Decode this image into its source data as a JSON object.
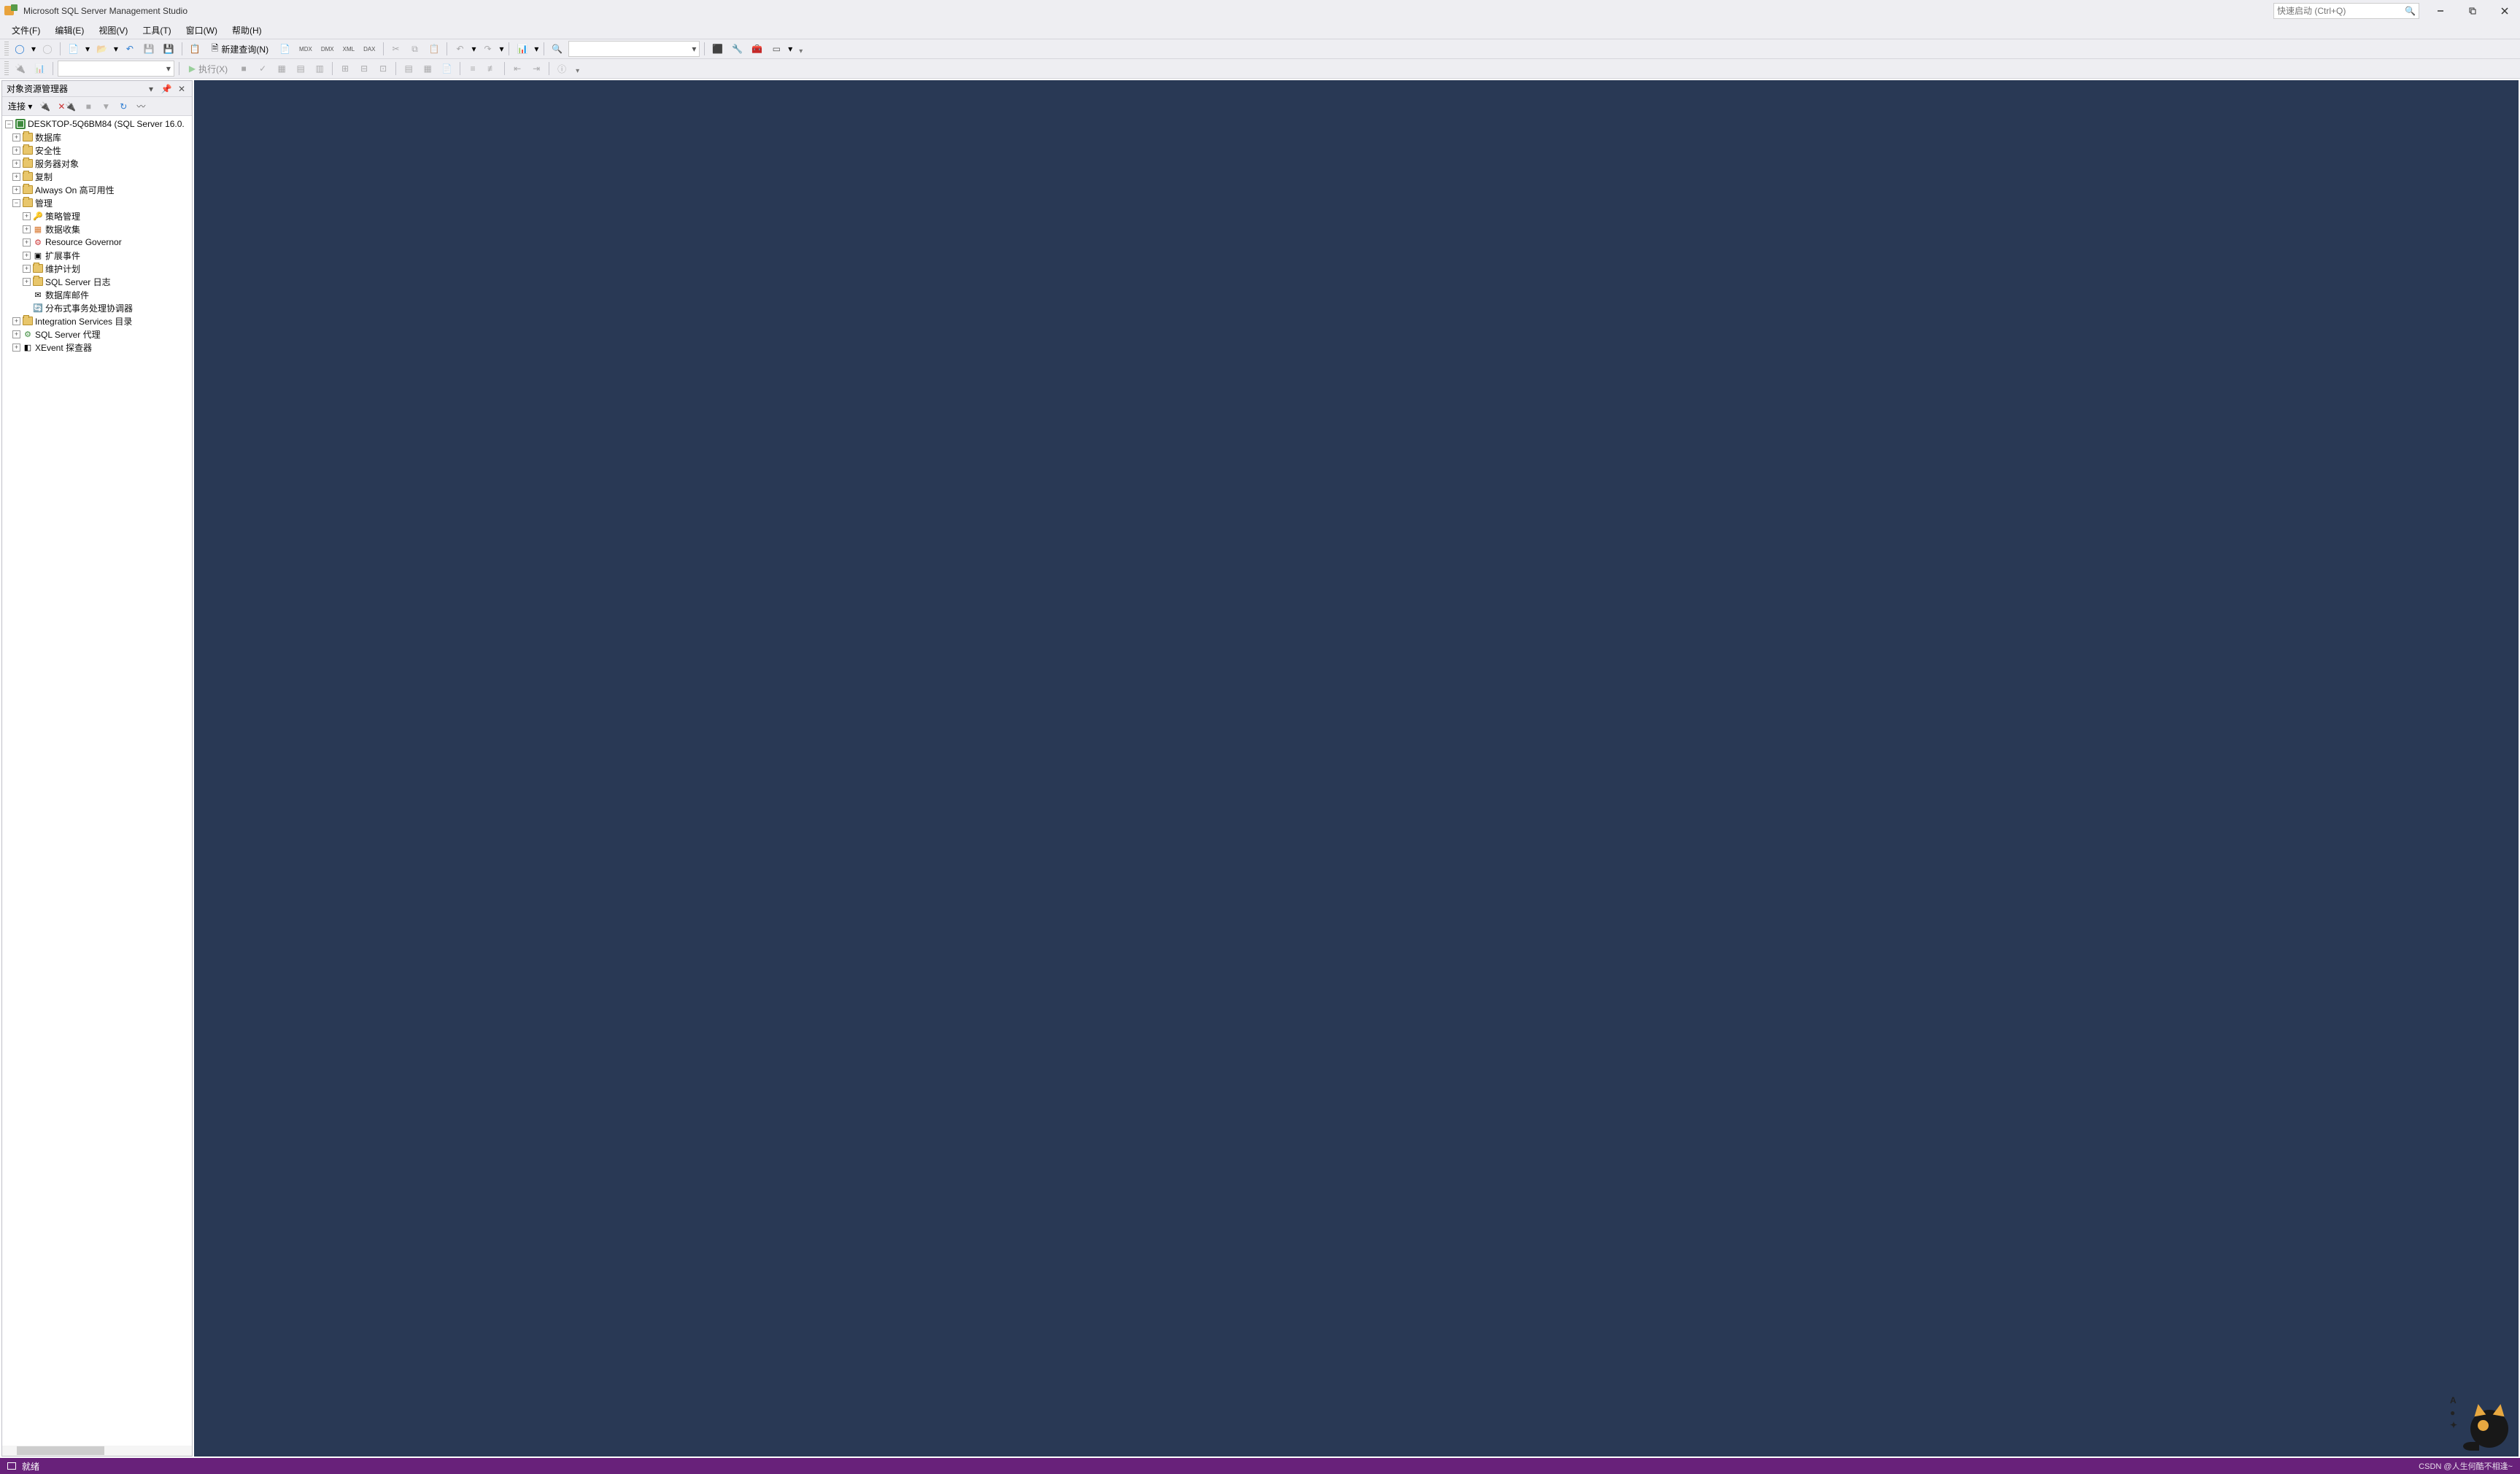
{
  "title": "Microsoft SQL Server Management Studio",
  "quick_launch_placeholder": "快速启动 (Ctrl+Q)",
  "menu": {
    "file": "文件(F)",
    "edit": "编辑(E)",
    "view": "视图(V)",
    "tools": "工具(T)",
    "window": "窗口(W)",
    "help": "帮助(H)"
  },
  "toolbar1": {
    "new_query": "新建查询(N)"
  },
  "toolbar2": {
    "execute": "执行(X)"
  },
  "object_explorer": {
    "title": "对象资源管理器",
    "connect": "连接",
    "root": "DESKTOP-5Q6BM84 (SQL Server 16.0.",
    "nodes": [
      {
        "label": "数据库",
        "icon": "folder",
        "exp": "+",
        "ind": 1
      },
      {
        "label": "安全性",
        "icon": "folder",
        "exp": "+",
        "ind": 1
      },
      {
        "label": "服务器对象",
        "icon": "folder",
        "exp": "+",
        "ind": 1
      },
      {
        "label": "复制",
        "icon": "folder",
        "exp": "+",
        "ind": 1
      },
      {
        "label": "Always On 高可用性",
        "icon": "folder",
        "exp": "+",
        "ind": 1
      },
      {
        "label": "管理",
        "icon": "folder",
        "exp": "-",
        "ind": 1
      },
      {
        "label": "策略管理",
        "icon": "policy",
        "exp": "+",
        "ind": 2
      },
      {
        "label": "数据收集",
        "icon": "data",
        "exp": "+",
        "ind": 2
      },
      {
        "label": "Resource Governor",
        "icon": "rg",
        "exp": "+",
        "ind": 2
      },
      {
        "label": "扩展事件",
        "icon": "ext",
        "exp": "+",
        "ind": 2
      },
      {
        "label": "维护计划",
        "icon": "folder",
        "exp": "+",
        "ind": 2
      },
      {
        "label": "SQL Server 日志",
        "icon": "folder",
        "exp": "+",
        "ind": 2
      },
      {
        "label": "数据库邮件",
        "icon": "mail",
        "exp": "",
        "ind": 2
      },
      {
        "label": "分布式事务处理协调器",
        "icon": "dtc",
        "exp": "",
        "ind": 2
      },
      {
        "label": "Integration Services 目录",
        "icon": "folder",
        "exp": "+",
        "ind": 1
      },
      {
        "label": "SQL Server 代理",
        "icon": "agent",
        "exp": "+",
        "ind": 1
      },
      {
        "label": "XEvent 探查器",
        "icon": "xe",
        "exp": "+",
        "ind": 1
      }
    ]
  },
  "status": {
    "ready": "就绪"
  },
  "watermark": "CSDN @人生何酷不相逢~",
  "mascot_letters": [
    "A",
    "●",
    "✦"
  ]
}
